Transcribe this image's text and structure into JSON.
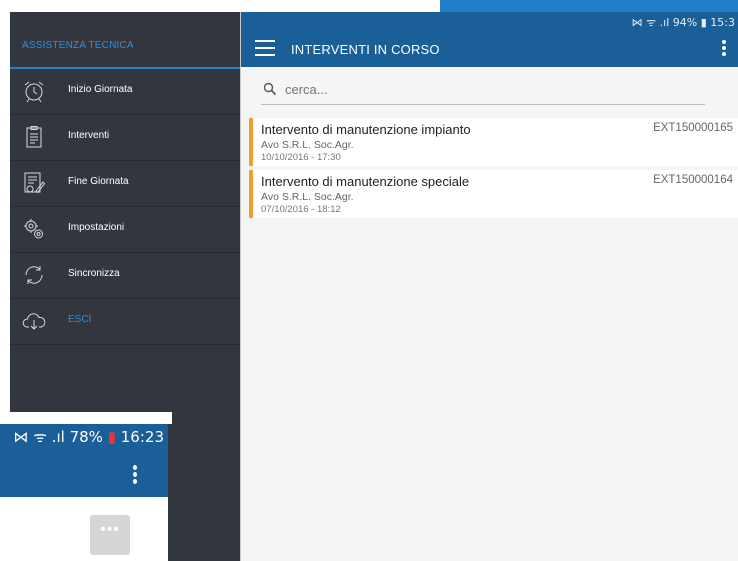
{
  "main": {
    "status": {
      "signal_icons": "⋈ ᯤ .ıl",
      "battery": "94%",
      "time": "15:3"
    },
    "toolbar": {
      "title": "INTERVENTI IN CORSO",
      "menu_icon": "hamburger-icon",
      "overflow_icon": "more-vertical-icon"
    },
    "search": {
      "placeholder": "cerca...",
      "value": ""
    },
    "interventions": [
      {
        "title": "Intervento di manutenzione impianto",
        "client": "Avo S.R.L. Soc.Agr.",
        "date": "10/10/2016 - 17:30",
        "code": "EXT150000165"
      },
      {
        "title": "Intervento di manutenzione speciale",
        "client": "Avo S.R.L. Soc.Agr.",
        "date": "07/10/2016 - 18:12",
        "code": "EXT150000164"
      }
    ]
  },
  "drawer": {
    "title": "ASSISTENZA TECNICA",
    "items": [
      {
        "label": "Inizio Giornata",
        "icon": "alarm-clock-icon"
      },
      {
        "label": "Interventi",
        "icon": "clipboard-icon"
      },
      {
        "label": "Fine Giornata",
        "icon": "calendar-edit-icon"
      },
      {
        "label": "Impostazioni",
        "icon": "gears-icon"
      },
      {
        "label": "Sincronizza",
        "icon": "sync-icon"
      },
      {
        "label": "ESCI",
        "icon": "cloud-download-icon"
      }
    ]
  },
  "phone": {
    "status": {
      "signal_icons": "⋈ ᯤ .ıl",
      "battery": "78%",
      "time": "16:23"
    },
    "more_label": "•••"
  },
  "colors": {
    "primary": "#1b5f98",
    "drawer_bg": "#32373f",
    "accent": "#2f8fd8",
    "card_marker": "#f0a030"
  }
}
